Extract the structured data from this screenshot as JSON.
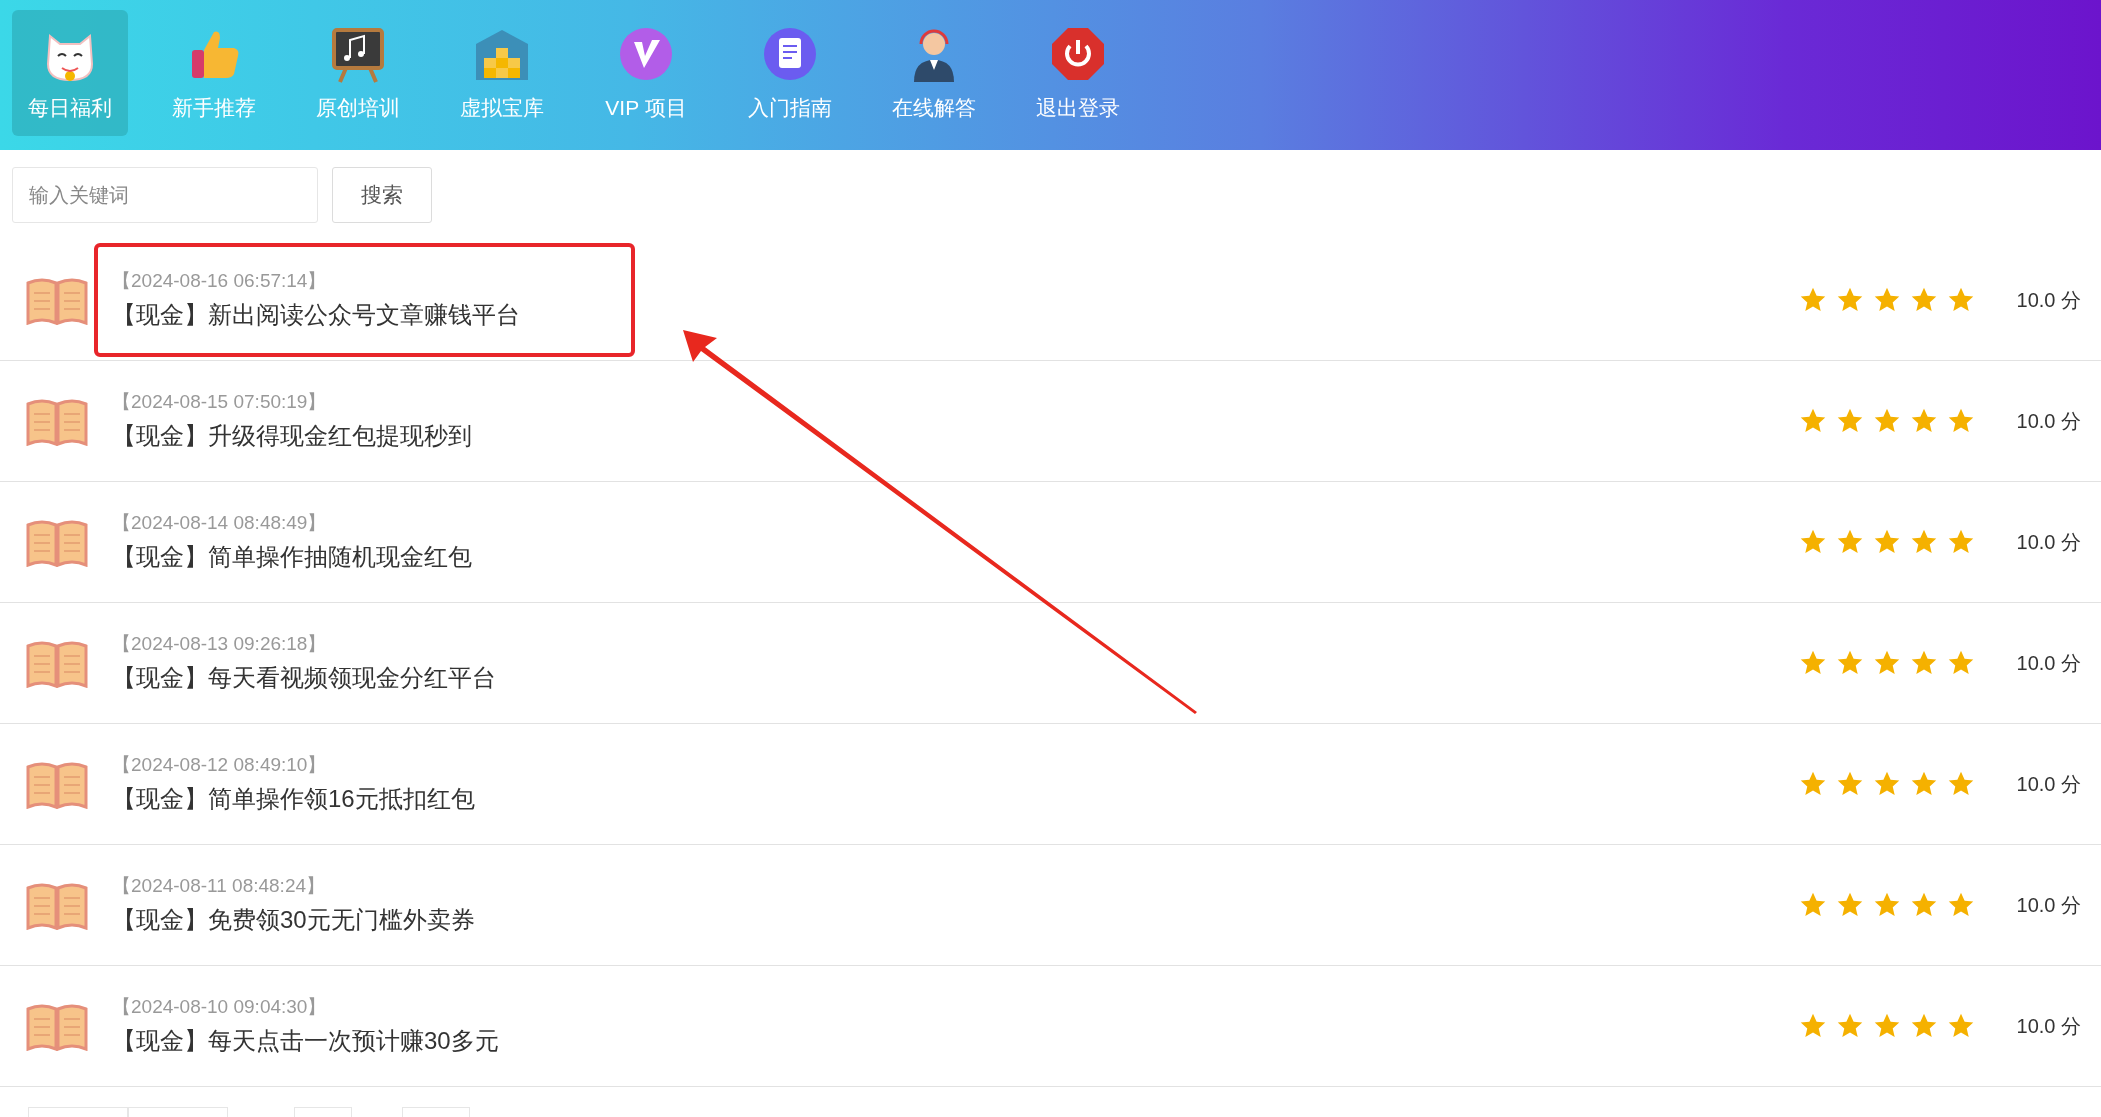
{
  "nav": [
    {
      "label": "每日福利",
      "selected": true
    },
    {
      "label": "新手推荐",
      "selected": false
    },
    {
      "label": "原创培训",
      "selected": false
    },
    {
      "label": "虚拟宝库",
      "selected": false
    },
    {
      "label": "VIP 项目",
      "selected": false
    },
    {
      "label": "入门指南",
      "selected": false
    },
    {
      "label": "在线解答",
      "selected": false
    },
    {
      "label": "退出登录",
      "selected": false
    }
  ],
  "search": {
    "placeholder": "输入关键词",
    "button": "搜索"
  },
  "articles": [
    {
      "time": "【2024-08-16 06:57:14】",
      "title": "【现金】新出阅读公众号文章赚钱平台",
      "stars": 5,
      "score": "10.0 分",
      "highlighted": true
    },
    {
      "time": "【2024-08-15 07:50:19】",
      "title": "【现金】升级得现金红包提现秒到",
      "stars": 5,
      "score": "10.0 分",
      "highlighted": false
    },
    {
      "time": "【2024-08-14 08:48:49】",
      "title": "【现金】简单操作抽随机现金红包",
      "stars": 5,
      "score": "10.0 分",
      "highlighted": false
    },
    {
      "time": "【2024-08-13 09:26:18】",
      "title": "【现金】每天看视频领现金分红平台",
      "stars": 5,
      "score": "10.0 分",
      "highlighted": false
    },
    {
      "time": "【2024-08-12 08:49:10】",
      "title": "【现金】简单操作领16元抵扣红包",
      "stars": 5,
      "score": "10.0 分",
      "highlighted": false
    },
    {
      "time": "【2024-08-11 08:48:24】",
      "title": "【现金】免费领30元无门槛外卖券",
      "stars": 5,
      "score": "10.0 分",
      "highlighted": false
    },
    {
      "time": "【2024-08-10 09:04:30】",
      "title": "【现金】每天点击一次预计赚30多元",
      "stars": 5,
      "score": "10.0 分",
      "highlighted": false
    }
  ]
}
